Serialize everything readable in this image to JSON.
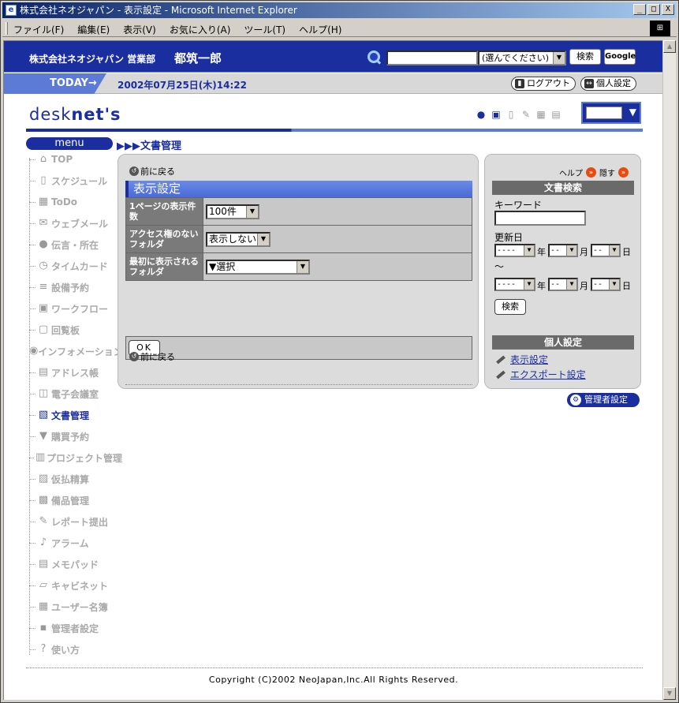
{
  "window": {
    "title": "株式会社ネオジャパン - 表示設定 - Microsoft Internet Explorer",
    "controls": {
      "minimize": "_",
      "maximize": "□",
      "close": "X"
    }
  },
  "menubar": [
    "ファイル(F)",
    "編集(E)",
    "表示(V)",
    "お気に入り(A)",
    "ツール(T)",
    "ヘルプ(H)"
  ],
  "header": {
    "company": "株式会社ネオジャパン 営業部",
    "user": "都筑一郎",
    "search_select": "(選んでください)",
    "search_button": "検索",
    "google_button": "Google"
  },
  "today": {
    "label": "TODAY→",
    "datetime": "2002年07月25日(木)14:22",
    "logout": "ログアウト",
    "personal": "個人設定"
  },
  "logo": {
    "part1": "desk",
    "part2": "net's"
  },
  "nav": {
    "menu_label": "menu",
    "breadcrumb": "▶▶▶文書管理"
  },
  "sidebar": [
    {
      "label": "TOP",
      "icon": "⌂"
    },
    {
      "label": "スケジュール",
      "icon": "▯"
    },
    {
      "label": "ToDo",
      "icon": "▦"
    },
    {
      "label": "ウェブメール",
      "icon": "✉"
    },
    {
      "label": "伝言・所在",
      "icon": "●"
    },
    {
      "label": "タイムカード",
      "icon": "◷"
    },
    {
      "label": "設備予約",
      "icon": "≡"
    },
    {
      "label": "ワークフロー",
      "icon": "▣"
    },
    {
      "label": "回覧板",
      "icon": "▢"
    },
    {
      "label": "インフォメーション",
      "icon": "◉"
    },
    {
      "label": "アドレス帳",
      "icon": "▤"
    },
    {
      "label": "電子会議室",
      "icon": "◫"
    },
    {
      "label": "文書管理",
      "icon": "▧"
    },
    {
      "label": "購買予約",
      "icon": "▼"
    },
    {
      "label": "プロジェクト管理",
      "icon": "▥"
    },
    {
      "label": "仮払精算",
      "icon": "▨"
    },
    {
      "label": "備品管理",
      "icon": "▩"
    },
    {
      "label": "レポート提出",
      "icon": "✎"
    },
    {
      "label": "アラーム",
      "icon": "♪"
    },
    {
      "label": "メモパッド",
      "icon": "▤"
    },
    {
      "label": "キャビネット",
      "icon": "▱"
    },
    {
      "label": "ユーザー名簿",
      "icon": "▦"
    },
    {
      "label": "管理者設定",
      "icon": "▪"
    },
    {
      "label": "使い方",
      "icon": "?"
    }
  ],
  "main": {
    "back_link": "前に戻る",
    "section_title": "表示設定",
    "rows": [
      {
        "label": "1ページの表示件数",
        "value": "100件"
      },
      {
        "label": "アクセス権のないフォルダ",
        "value": "表示しない"
      },
      {
        "label": "最初に表示されるフォルダ",
        "value": "▼選択"
      }
    ],
    "ok_button": "OK",
    "back_link_bottom": "前に戻る"
  },
  "right": {
    "help": "ヘルプ",
    "hide": "隠す",
    "doc_search_title": "文書検索",
    "keyword_label": "キーワード",
    "updated_label": "更新日",
    "tilde": "～",
    "year_placeholder": "----",
    "md_placeholder": "--",
    "unit_year": "年",
    "unit_month": "月",
    "unit_day": "日",
    "search_button": "検索",
    "personal_title": "個人設定",
    "link_display": "表示設定",
    "link_export": "エクスポート設定"
  },
  "admin_button": "管理者設定",
  "copyright": "Copyright (C)2002 NeoJapan,Inc.All Rights Reserved."
}
